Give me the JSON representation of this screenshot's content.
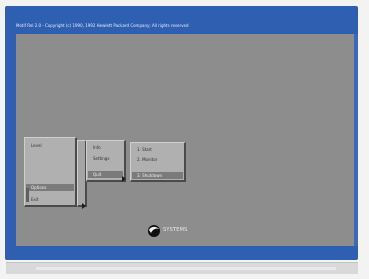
{
  "window": {
    "title": "Motif Rel 2.0 - Copyright (c) 1990, 1992 Hewlett Packard Company; All rights reserved"
  },
  "menus": {
    "main": {
      "items": [
        {
          "label": "Level"
        },
        {
          "label": "Options"
        },
        {
          "label": "Exit"
        }
      ]
    },
    "sub": {
      "items": [
        {
          "label": "Info"
        },
        {
          "label": "Settings"
        },
        {
          "label": "Quit"
        }
      ]
    },
    "sub2": {
      "items": [
        {
          "label": "1. Start"
        },
        {
          "label": "2. Monitor"
        },
        {
          "label": "3. Shutdown"
        }
      ]
    }
  },
  "logo": {
    "text": "SYSTEMS"
  },
  "colors": {
    "frame": "#2f5fb0",
    "desktop": "#8d8d8d",
    "menu": "#b0b0b0",
    "selection": "#7b7b7b"
  }
}
